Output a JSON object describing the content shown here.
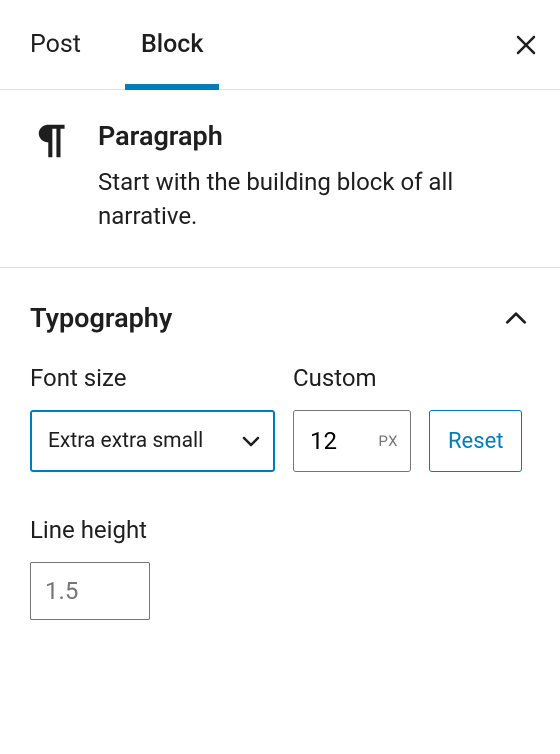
{
  "tabs": {
    "post": "Post",
    "block": "Block",
    "active": "block"
  },
  "block": {
    "title": "Paragraph",
    "description": "Start with the building block of all narrative."
  },
  "typography": {
    "section_title": "Typography",
    "font_size_label": "Font size",
    "font_size_value": "Extra extra small",
    "custom_label": "Custom",
    "custom_value": "12",
    "custom_unit": "PX",
    "reset_label": "Reset",
    "line_height_label": "Line height",
    "line_height_placeholder": "1.5",
    "line_height_value": ""
  }
}
